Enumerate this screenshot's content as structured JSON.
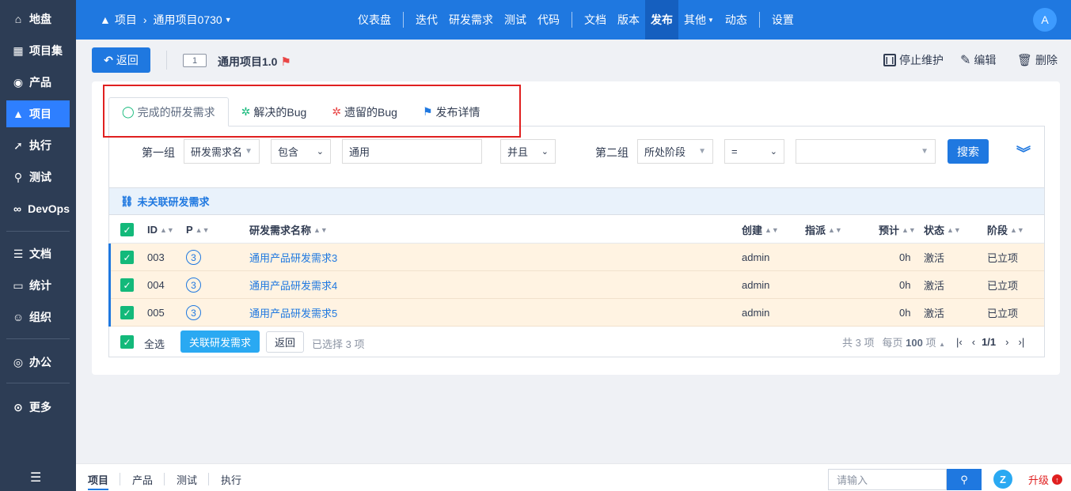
{
  "sidebar": {
    "items": [
      {
        "label": "地盘",
        "icon": "home-icon"
      },
      {
        "label": "项目集",
        "icon": "grid-icon"
      },
      {
        "label": "产品",
        "icon": "bulb-icon"
      },
      {
        "label": "项目",
        "icon": "rocket-icon"
      },
      {
        "label": "执行",
        "icon": "run-icon"
      },
      {
        "label": "测试",
        "icon": "search-icon"
      },
      {
        "label": "DevOps",
        "icon": "infinity-icon"
      },
      {
        "label": "文档",
        "icon": "doc-icon"
      },
      {
        "label": "统计",
        "icon": "chart-icon"
      },
      {
        "label": "组织",
        "icon": "user-icon"
      },
      {
        "label": "办公",
        "icon": "oa-icon"
      },
      {
        "label": "更多",
        "icon": "more-icon"
      }
    ]
  },
  "header": {
    "crumb_root": "项目",
    "crumb_project": "通用项目0730",
    "nav": [
      "仪表盘",
      "迭代",
      "研发需求",
      "测试",
      "代码",
      "文档",
      "版本",
      "发布",
      "其他",
      "动态",
      "设置"
    ],
    "avatar": "A"
  },
  "toolbar": {
    "back_label": "返回",
    "release_id": "1",
    "release_title": "通用项目1.0",
    "stop_label": "停止维护",
    "edit_label": "编辑",
    "delete_label": "删除"
  },
  "tabs": [
    {
      "label": "完成的研发需求"
    },
    {
      "label": "解决的Bug"
    },
    {
      "label": "遗留的Bug"
    },
    {
      "label": "发布详情"
    }
  ],
  "search": {
    "group1_label": "第一组",
    "field1": "研发需求名",
    "op1": "包含",
    "value1": "通用",
    "logic": "并且",
    "group2_label": "第二组",
    "field2": "所处阶段",
    "op2": "=",
    "value2": "",
    "search_label": "搜索"
  },
  "unlinked_title": "未关联研发需求",
  "table": {
    "headers": {
      "id": "ID",
      "pri": "P",
      "name": "研发需求名称",
      "creator": "创建",
      "assigned": "指派",
      "estimate": "预计",
      "status": "状态",
      "stage": "阶段"
    },
    "rows": [
      {
        "id": "003",
        "pri": "3",
        "name": "通用产品研发需求3",
        "creator": "admin",
        "assigned": "",
        "estimate": "0h",
        "status": "激活",
        "stage": "已立项"
      },
      {
        "id": "004",
        "pri": "3",
        "name": "通用产品研发需求4",
        "creator": "admin",
        "assigned": "",
        "estimate": "0h",
        "status": "激活",
        "stage": "已立项"
      },
      {
        "id": "005",
        "pri": "3",
        "name": "通用产品研发需求5",
        "creator": "admin",
        "assigned": "",
        "estimate": "0h",
        "status": "激活",
        "stage": "已立项"
      }
    ]
  },
  "footer": {
    "select_all": "全选",
    "link_btn": "关联研发需求",
    "return_btn": "返回",
    "selected_text": "已选择 3 项",
    "total_text": "共 3 项",
    "per_page_prefix": "每页",
    "per_page": "100",
    "per_page_suffix": "项",
    "page": "1/1"
  },
  "bottom": {
    "tabs": [
      "项目",
      "产品",
      "测试",
      "执行"
    ],
    "search_placeholder": "请输入",
    "upgrade_label": "升级"
  }
}
